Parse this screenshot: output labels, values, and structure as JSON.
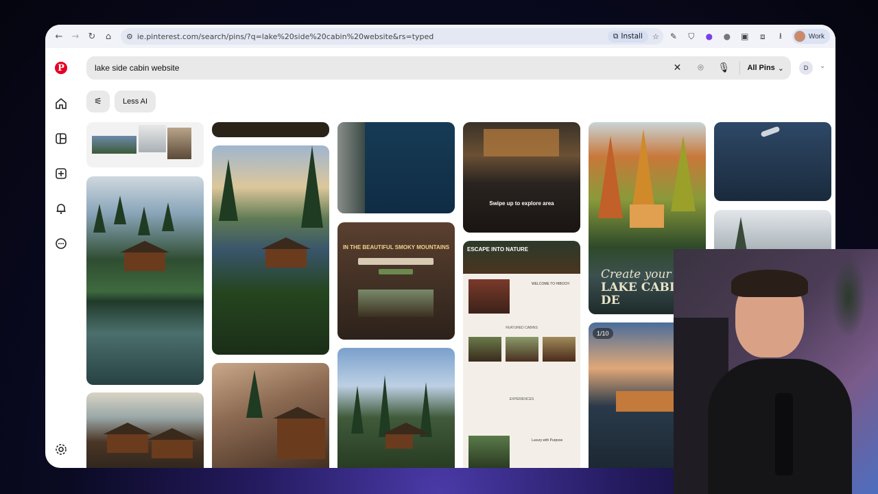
{
  "browser": {
    "url": "ie.pinterest.com/search/pins/?q=lake%20side%20cabin%20website&rs=typed",
    "install_label": "Install",
    "profile_label": "Work"
  },
  "search": {
    "query": "lake side cabin website",
    "scope_label": "All Pins",
    "user_initial": "D"
  },
  "filters": {
    "less_ai_label": "Less AI"
  },
  "pins": {
    "swipe_text": "Swipe up to explore area",
    "smoky_title": "IN THE BEAUTIFUL SMOKY MOUNTAINS",
    "escape_title": "ESCAPE INTO NATURE",
    "welcome_label": "WELCOME TO HIBOCH",
    "featured_label": "FEATURED CABINS",
    "experiences_label": "EXPERIENCES",
    "luxury_label": "Luxury with Purpose",
    "overlay_title_1": "Create your DRE",
    "overlay_title_2": "LAKE CABIN DE",
    "counter": "1/10"
  },
  "icons": [
    "back-icon",
    "forward-icon",
    "reload-icon",
    "home-icon",
    "site-settings-icon",
    "install-icon",
    "star-icon",
    "pen-icon",
    "shield-icon",
    "extension-icon",
    "puzzle-icon",
    "download-icon",
    "pinterest-logo",
    "explore-icon",
    "create-icon",
    "notifications-icon",
    "messages-icon",
    "settings-icon",
    "clear-icon",
    "camera-search-icon",
    "mic-icon",
    "filter-icon"
  ]
}
